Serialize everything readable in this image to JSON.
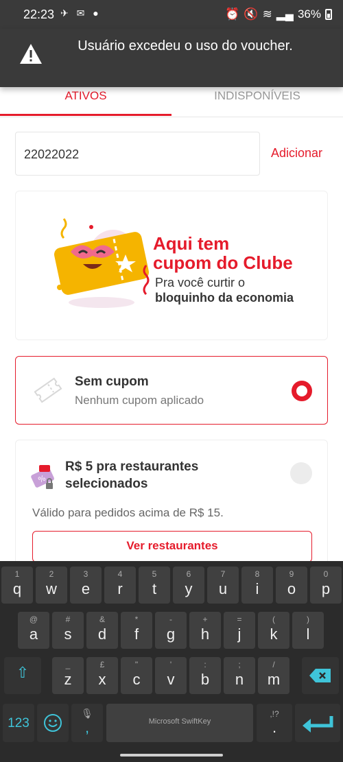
{
  "status_bar": {
    "time": "22:23",
    "battery": "36%"
  },
  "toast": {
    "message": "Usuário excedeu o uso do voucher."
  },
  "tabs": [
    {
      "label": "ATIVOS"
    },
    {
      "label": "INDISPONÍVEIS"
    }
  ],
  "coupon_form": {
    "value": "22022022",
    "add_label": "Adicionar"
  },
  "banner": {
    "title_line1": "Aqui tem",
    "title_line2": "cupom do Clube",
    "sub_line1": "Pra você curtir o",
    "sub_line2": "bloquinho da economia"
  },
  "no_coupon": {
    "title": "Sem cupom",
    "subtitle": "Nenhum cupom aplicado"
  },
  "promo": {
    "title": "R$ 5 pra restaurantes selecionados",
    "valid": "Válido para pedidos acima de R$ 15.",
    "button": "Ver restaurantes"
  },
  "keyboard": {
    "row1": [
      {
        "k": "q",
        "h": "1"
      },
      {
        "k": "w",
        "h": "2"
      },
      {
        "k": "e",
        "h": "3"
      },
      {
        "k": "r",
        "h": "4"
      },
      {
        "k": "t",
        "h": "5"
      },
      {
        "k": "y",
        "h": "6"
      },
      {
        "k": "u",
        "h": "7"
      },
      {
        "k": "i",
        "h": "8"
      },
      {
        "k": "o",
        "h": "9"
      },
      {
        "k": "p",
        "h": "0"
      }
    ],
    "row2": [
      {
        "k": "a",
        "h": "@"
      },
      {
        "k": "s",
        "h": "#"
      },
      {
        "k": "d",
        "h": "&"
      },
      {
        "k": "f",
        "h": "*"
      },
      {
        "k": "g",
        "h": "-"
      },
      {
        "k": "h",
        "h": "+"
      },
      {
        "k": "j",
        "h": "="
      },
      {
        "k": "k",
        "h": "("
      },
      {
        "k": "l",
        "h": ")"
      }
    ],
    "row3": [
      {
        "k": "z",
        "h": "_"
      },
      {
        "k": "x",
        "h": "£"
      },
      {
        "k": "c",
        "h": "\""
      },
      {
        "k": "v",
        "h": "'"
      },
      {
        "k": "b",
        "h": ":"
      },
      {
        "k": "n",
        "h": ";"
      },
      {
        "k": "m",
        "h": "/"
      }
    ],
    "num_label": "123",
    "comma": ",",
    "period": ".",
    "punct_hint": ",!?",
    "space_label": "Microsoft SwiftKey"
  }
}
